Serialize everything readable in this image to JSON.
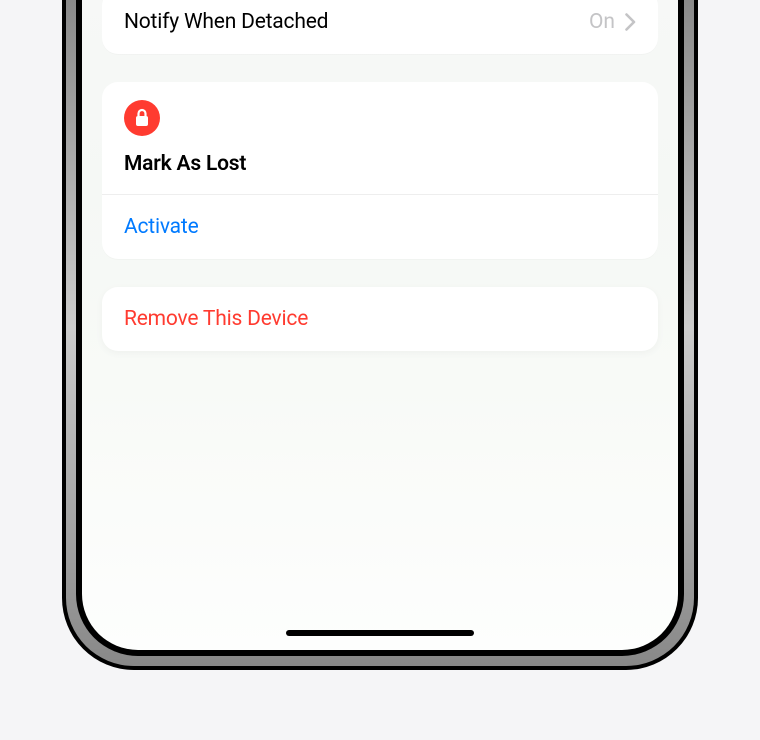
{
  "colors": {
    "destructive": "#ff3b30",
    "link": "#007aff",
    "secondary": "#c4c4c6"
  },
  "notify_row": {
    "label": "Notify When Detached",
    "value": "On"
  },
  "lost_mode": {
    "icon_name": "lock-icon",
    "title": "Mark As Lost",
    "action": "Activate"
  },
  "remove": {
    "label": "Remove This Device"
  }
}
